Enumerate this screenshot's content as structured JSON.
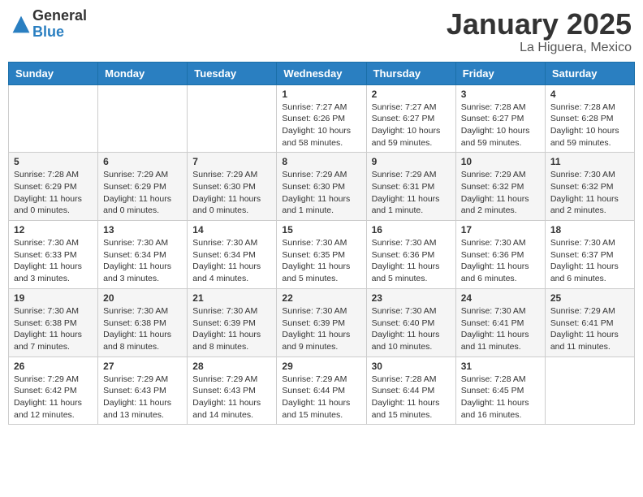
{
  "header": {
    "logo_general": "General",
    "logo_blue": "Blue",
    "month_title": "January 2025",
    "subtitle": "La Higuera, Mexico"
  },
  "days_of_week": [
    "Sunday",
    "Monday",
    "Tuesday",
    "Wednesday",
    "Thursday",
    "Friday",
    "Saturday"
  ],
  "weeks": [
    [
      {
        "day": "",
        "info": ""
      },
      {
        "day": "",
        "info": ""
      },
      {
        "day": "",
        "info": ""
      },
      {
        "day": "1",
        "info": "Sunrise: 7:27 AM\nSunset: 6:26 PM\nDaylight: 10 hours\nand 58 minutes."
      },
      {
        "day": "2",
        "info": "Sunrise: 7:27 AM\nSunset: 6:27 PM\nDaylight: 10 hours\nand 59 minutes."
      },
      {
        "day": "3",
        "info": "Sunrise: 7:28 AM\nSunset: 6:27 PM\nDaylight: 10 hours\nand 59 minutes."
      },
      {
        "day": "4",
        "info": "Sunrise: 7:28 AM\nSunset: 6:28 PM\nDaylight: 10 hours\nand 59 minutes."
      }
    ],
    [
      {
        "day": "5",
        "info": "Sunrise: 7:28 AM\nSunset: 6:29 PM\nDaylight: 11 hours\nand 0 minutes."
      },
      {
        "day": "6",
        "info": "Sunrise: 7:29 AM\nSunset: 6:29 PM\nDaylight: 11 hours\nand 0 minutes."
      },
      {
        "day": "7",
        "info": "Sunrise: 7:29 AM\nSunset: 6:30 PM\nDaylight: 11 hours\nand 0 minutes."
      },
      {
        "day": "8",
        "info": "Sunrise: 7:29 AM\nSunset: 6:30 PM\nDaylight: 11 hours\nand 1 minute."
      },
      {
        "day": "9",
        "info": "Sunrise: 7:29 AM\nSunset: 6:31 PM\nDaylight: 11 hours\nand 1 minute."
      },
      {
        "day": "10",
        "info": "Sunrise: 7:29 AM\nSunset: 6:32 PM\nDaylight: 11 hours\nand 2 minutes."
      },
      {
        "day": "11",
        "info": "Sunrise: 7:30 AM\nSunset: 6:32 PM\nDaylight: 11 hours\nand 2 minutes."
      }
    ],
    [
      {
        "day": "12",
        "info": "Sunrise: 7:30 AM\nSunset: 6:33 PM\nDaylight: 11 hours\nand 3 minutes."
      },
      {
        "day": "13",
        "info": "Sunrise: 7:30 AM\nSunset: 6:34 PM\nDaylight: 11 hours\nand 3 minutes."
      },
      {
        "day": "14",
        "info": "Sunrise: 7:30 AM\nSunset: 6:34 PM\nDaylight: 11 hours\nand 4 minutes."
      },
      {
        "day": "15",
        "info": "Sunrise: 7:30 AM\nSunset: 6:35 PM\nDaylight: 11 hours\nand 5 minutes."
      },
      {
        "day": "16",
        "info": "Sunrise: 7:30 AM\nSunset: 6:36 PM\nDaylight: 11 hours\nand 5 minutes."
      },
      {
        "day": "17",
        "info": "Sunrise: 7:30 AM\nSunset: 6:36 PM\nDaylight: 11 hours\nand 6 minutes."
      },
      {
        "day": "18",
        "info": "Sunrise: 7:30 AM\nSunset: 6:37 PM\nDaylight: 11 hours\nand 6 minutes."
      }
    ],
    [
      {
        "day": "19",
        "info": "Sunrise: 7:30 AM\nSunset: 6:38 PM\nDaylight: 11 hours\nand 7 minutes."
      },
      {
        "day": "20",
        "info": "Sunrise: 7:30 AM\nSunset: 6:38 PM\nDaylight: 11 hours\nand 8 minutes."
      },
      {
        "day": "21",
        "info": "Sunrise: 7:30 AM\nSunset: 6:39 PM\nDaylight: 11 hours\nand 8 minutes."
      },
      {
        "day": "22",
        "info": "Sunrise: 7:30 AM\nSunset: 6:39 PM\nDaylight: 11 hours\nand 9 minutes."
      },
      {
        "day": "23",
        "info": "Sunrise: 7:30 AM\nSunset: 6:40 PM\nDaylight: 11 hours\nand 10 minutes."
      },
      {
        "day": "24",
        "info": "Sunrise: 7:30 AM\nSunset: 6:41 PM\nDaylight: 11 hours\nand 11 minutes."
      },
      {
        "day": "25",
        "info": "Sunrise: 7:29 AM\nSunset: 6:41 PM\nDaylight: 11 hours\nand 11 minutes."
      }
    ],
    [
      {
        "day": "26",
        "info": "Sunrise: 7:29 AM\nSunset: 6:42 PM\nDaylight: 11 hours\nand 12 minutes."
      },
      {
        "day": "27",
        "info": "Sunrise: 7:29 AM\nSunset: 6:43 PM\nDaylight: 11 hours\nand 13 minutes."
      },
      {
        "day": "28",
        "info": "Sunrise: 7:29 AM\nSunset: 6:43 PM\nDaylight: 11 hours\nand 14 minutes."
      },
      {
        "day": "29",
        "info": "Sunrise: 7:29 AM\nSunset: 6:44 PM\nDaylight: 11 hours\nand 15 minutes."
      },
      {
        "day": "30",
        "info": "Sunrise: 7:28 AM\nSunset: 6:44 PM\nDaylight: 11 hours\nand 15 minutes."
      },
      {
        "day": "31",
        "info": "Sunrise: 7:28 AM\nSunset: 6:45 PM\nDaylight: 11 hours\nand 16 minutes."
      },
      {
        "day": "",
        "info": ""
      }
    ]
  ]
}
